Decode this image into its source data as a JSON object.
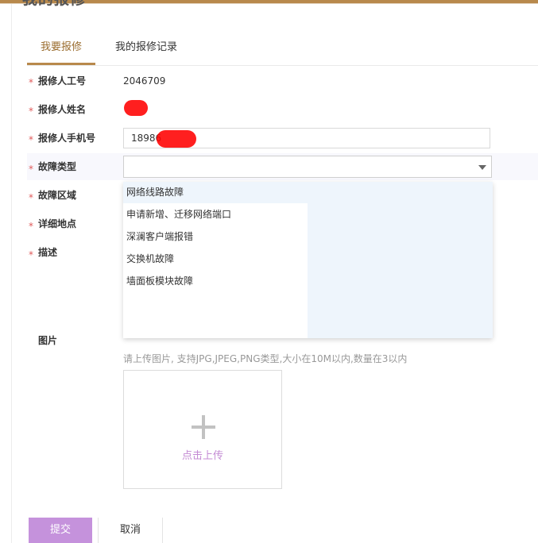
{
  "header": {
    "title": "我的报修"
  },
  "tabs": [
    {
      "label": "我要报修",
      "active": true
    },
    {
      "label": "我的报修记录",
      "active": false
    }
  ],
  "form": {
    "required_mark": "*",
    "employee_id": {
      "label": "报修人工号",
      "value": "2046709"
    },
    "name": {
      "label": "报修人姓名",
      "value": "",
      "redacted": true
    },
    "phone": {
      "label": "报修人手机号",
      "value": "18986",
      "redacted_suffix": true
    },
    "fault_type": {
      "label": "故障类型",
      "value": ""
    },
    "fault_area": {
      "label": "故障区域"
    },
    "location": {
      "label": "详细地点"
    },
    "description": {
      "label": "描述"
    },
    "image": {
      "label": "图片",
      "hint": "请上传图片, 支持JPG,JPEG,PNG类型,大小在10M以内,数量在3以内",
      "upload_label": "点击上传"
    }
  },
  "dropdown": {
    "options": [
      "网络线路故障",
      "申请新增、迁移网络端口",
      "深澜客户端报错",
      "交换机故障",
      "墙面板模块故障"
    ],
    "highlighted_index": 0
  },
  "buttons": {
    "submit": "提交",
    "cancel": "取消"
  },
  "colors": {
    "accent": "#b8894c",
    "submit_bg": "#c592dc",
    "upload_text": "#c48bd4",
    "required": "#e05a5a",
    "dropdown_bg": "#eef5fc",
    "redaction": "#ff0000"
  }
}
